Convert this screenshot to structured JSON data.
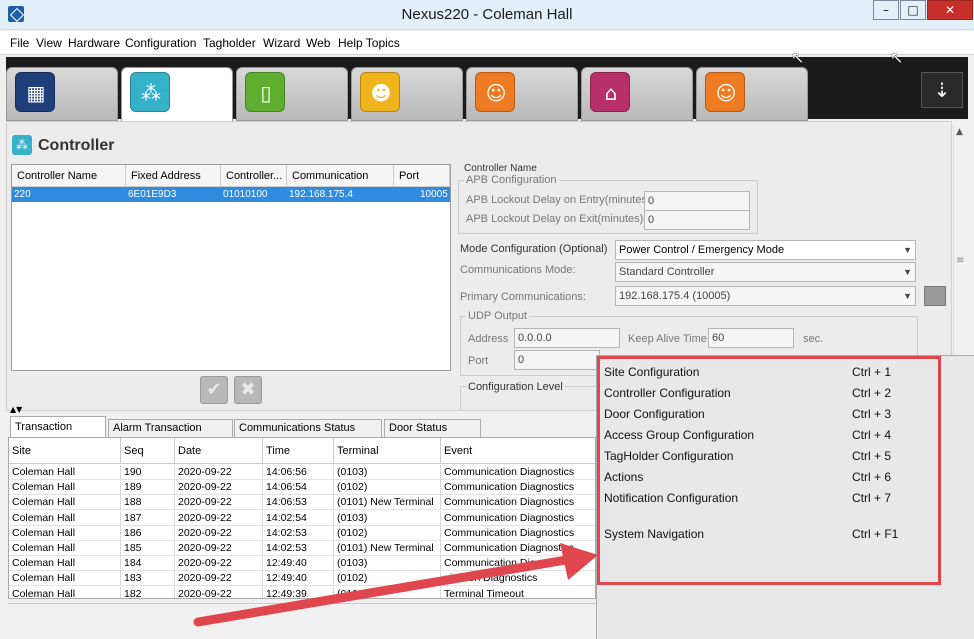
{
  "window": {
    "title": "Nexus220 - Coleman Hall"
  },
  "menu": [
    "File",
    "View",
    "Hardware",
    "Configuration",
    "Tagholder",
    "Wizard",
    "Web",
    "Help Topics"
  ],
  "ribbon": {
    "tabs": [
      {
        "icon": "system-icon",
        "color": "#1f3f7a"
      },
      {
        "icon": "controller-icon",
        "color": "#36b2c8"
      },
      {
        "icon": "door-icon",
        "color": "#5fae2f"
      },
      {
        "icon": "access-group-icon",
        "color": "#f0b41c"
      },
      {
        "icon": "tagholder-icon",
        "color": "#ef7b22"
      },
      {
        "icon": "home-icon",
        "color": "#b8306a"
      },
      {
        "icon": "notification-user-icon",
        "color": "#ef7b22"
      }
    ]
  },
  "page": {
    "title": "Controller"
  },
  "controller_grid": {
    "headers": [
      "Controller Name",
      "Fixed Address",
      "Controller...",
      "Communication Ch...",
      "Port"
    ],
    "rows": [
      [
        "220",
        "6E01E9D3",
        "01010100",
        "192.168.175.4",
        "10005"
      ]
    ]
  },
  "form": {
    "controller_name_label": "Controller Name",
    "apb_group": "APB Configuration",
    "apb_entry_label": "APB Lockout Delay on Entry(minutes)",
    "apb_entry_value": "0",
    "apb_exit_label": "APB Lockout Delay on Exit(minutes)",
    "apb_exit_value": "0",
    "mode_label": "Mode Configuration (Optional)",
    "mode_value": "Power Control / Emergency Mode",
    "comm_mode_label": "Communications Mode:",
    "comm_mode_value": "Standard Controller",
    "primary_label": "Primary Communications:",
    "primary_value": "192.168.175.4 (10005)",
    "udp_group": "UDP Output",
    "address_label": "Address",
    "address_value": "0.0.0.0",
    "keepalive_label": "Keep Alive Time",
    "keepalive_value": "60",
    "keepalive_unit": "sec.",
    "port_label": "Port",
    "port_value": "0",
    "config_level_group": "Configuration Level"
  },
  "bottom_tabs": [
    "Transaction Viewer",
    "Alarm Transaction Viewer",
    "Communications Status Viewer",
    "Door Status Viewer"
  ],
  "transactions": {
    "headers": [
      "Site",
      "Seq",
      "Date",
      "Time",
      "Terminal",
      "Event"
    ],
    "rows": [
      [
        "Coleman Hall",
        "190",
        "2020-09-22",
        "14:06:56",
        "(0103)",
        "Communication Diagnostics"
      ],
      [
        "Coleman Hall",
        "189",
        "2020-09-22",
        "14:06:54",
        "(0102)",
        "Communication Diagnostics"
      ],
      [
        "Coleman Hall",
        "188",
        "2020-09-22",
        "14:06:53",
        "(0101) New Terminal",
        "Communication Diagnostics"
      ],
      [
        "Coleman Hall",
        "187",
        "2020-09-22",
        "14:02:54",
        "(0103)",
        "Communication Diagnostics"
      ],
      [
        "Coleman Hall",
        "186",
        "2020-09-22",
        "14:02:53",
        "(0102)",
        "Communication Diagnostics"
      ],
      [
        "Coleman Hall",
        "185",
        "2020-09-22",
        "14:02:53",
        "(0101) New Terminal",
        "Communication Diagnostics"
      ],
      [
        "Coleman Hall",
        "184",
        "2020-09-22",
        "12:49:40",
        "(0103)",
        "Communication Diagno"
      ],
      [
        "Coleman Hall",
        "183",
        "2020-09-22",
        "12:49:40",
        "(0102)",
        "nication Diagnostics"
      ],
      [
        "Coleman Hall",
        "182",
        "2020-09-22",
        "12:49:39",
        "(010",
        "Terminal Timeout"
      ]
    ]
  },
  "nav_menu": {
    "items": [
      {
        "label": "Site Configuration",
        "shortcut": "Ctrl + 1"
      },
      {
        "label": "Controller Configuration",
        "shortcut": "Ctrl + 2"
      },
      {
        "label": "Door Configuration",
        "shortcut": "Ctrl + 3"
      },
      {
        "label": "Access Group Configuration",
        "shortcut": "Ctrl + 4"
      },
      {
        "label": "TagHolder Configuration",
        "shortcut": "Ctrl + 5"
      },
      {
        "label": "Actions",
        "shortcut": "Ctrl + 6"
      },
      {
        "label": "Notification Configuration",
        "shortcut": "Ctrl + 7"
      }
    ],
    "system": {
      "label": "System Navigation",
      "shortcut": "Ctrl + F1"
    }
  },
  "annotation": {
    "color": "#e0464e"
  }
}
